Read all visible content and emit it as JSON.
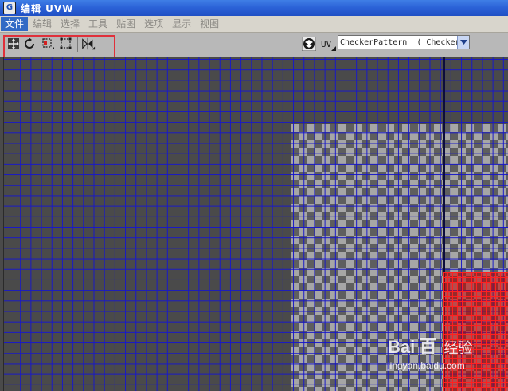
{
  "window": {
    "title": "编辑 UVW",
    "icon": "3ds-max-app-icon"
  },
  "menu": {
    "items": [
      "文件",
      "编辑",
      "选择",
      "工具",
      "贴图",
      "选项",
      "显示",
      "视图"
    ],
    "active_index": 0
  },
  "toolbar": {
    "tools": [
      {
        "name": "move-icon"
      },
      {
        "name": "rotate-icon"
      },
      {
        "name": "scale-icon"
      },
      {
        "name": "freeform-icon"
      },
      {
        "name": "mirror-icon"
      }
    ],
    "uv_label": "UV",
    "texture_select": {
      "value": "CheckerPattern  ( Checker"
    }
  },
  "viewport": {
    "grid_color": "#1818c8",
    "mesh_color": "#ff2020"
  },
  "watermark": {
    "logo_text": "Bai",
    "logo_suffix": "百",
    "cn_text": "经验",
    "url": "jingyan.baidu.com"
  },
  "colors": {
    "title_bar": "#2c63d8",
    "menu_active": "#316ac5",
    "highlight_box": "#e0303a"
  }
}
